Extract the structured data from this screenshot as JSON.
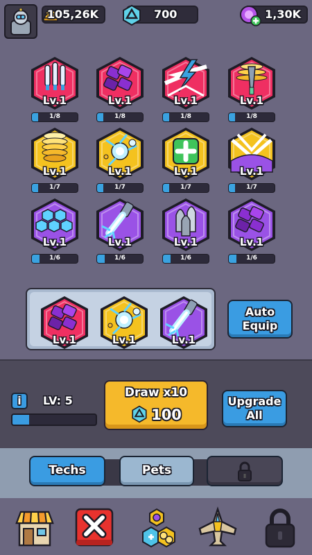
{
  "resources": {
    "gold": "105,26K",
    "gems": "700",
    "orbs": "1,30K"
  },
  "techs": [
    {
      "name": "missiles",
      "level": "Lv.1",
      "progress": "1/8",
      "fraction": 0.125,
      "color": "#ef2f62",
      "art": "missiles"
    },
    {
      "name": "purple-bombs",
      "level": "Lv.1",
      "progress": "1/8",
      "fraction": 0.125,
      "color": "#ef2f62",
      "art": "bombs"
    },
    {
      "name": "lightning",
      "level": "Lv.1",
      "progress": "1/8",
      "fraction": 0.125,
      "color": "#ef2f62",
      "art": "lightning"
    },
    {
      "name": "drill-laser",
      "level": "Lv.1",
      "progress": "1/8",
      "fraction": 0.125,
      "color": "#ef2f62",
      "art": "drill"
    },
    {
      "name": "gold-coil",
      "level": "Lv.1",
      "progress": "1/7",
      "fraction": 0.14,
      "color": "#f4c21f",
      "art": "coil"
    },
    {
      "name": "plasma-orb",
      "level": "Lv.1",
      "progress": "1/7",
      "fraction": 0.14,
      "color": "#f4c21f",
      "art": "orb"
    },
    {
      "name": "repair",
      "level": "Lv.1",
      "progress": "1/7",
      "fraction": 0.14,
      "color": "#f4c21f",
      "art": "repair"
    },
    {
      "name": "wing-blade",
      "level": "Lv.1",
      "progress": "1/7",
      "fraction": 0.14,
      "color": "#f4c21f",
      "art": "wing"
    },
    {
      "name": "hex-shield",
      "level": "Lv.1",
      "progress": "1/6",
      "fraction": 0.17,
      "color": "#9a52e6",
      "art": "hexshield"
    },
    {
      "name": "energy-beam",
      "level": "Lv.1",
      "progress": "1/6",
      "fraction": 0.17,
      "color": "#9a52e6",
      "art": "beam"
    },
    {
      "name": "rockets",
      "level": "Lv.1",
      "progress": "1/6",
      "fraction": 0.17,
      "color": "#9a52e6",
      "art": "rockets"
    },
    {
      "name": "purple-bombs-2",
      "level": "Lv.1",
      "progress": "1/6",
      "fraction": 0.17,
      "color": "#9a52e6",
      "art": "bombs"
    }
  ],
  "equipped": [
    {
      "name": "purple-bombs",
      "level": "Lv.1",
      "color": "#ef2f62",
      "art": "bombs"
    },
    {
      "name": "plasma-orb",
      "level": "Lv.1",
      "color": "#f4c21f",
      "art": "orb"
    },
    {
      "name": "energy-beam",
      "level": "Lv.1",
      "color": "#9a52e6",
      "art": "beam"
    }
  ],
  "buttons": {
    "auto_equip": "Auto Equip",
    "draw_title": "Draw x10",
    "draw_cost": "100",
    "upgrade_all": "Upgrade All"
  },
  "player": {
    "info_icon": "i",
    "level_text": "LV: 5",
    "level_progress": 0.2
  },
  "tabs": [
    {
      "label": "Techs",
      "active": true
    },
    {
      "label": "Pets",
      "active": false
    },
    {
      "label": "",
      "locked": true
    }
  ],
  "nav": [
    "shop-icon",
    "close-icon",
    "techs-icon",
    "ship-icon",
    "lock-icon"
  ]
}
